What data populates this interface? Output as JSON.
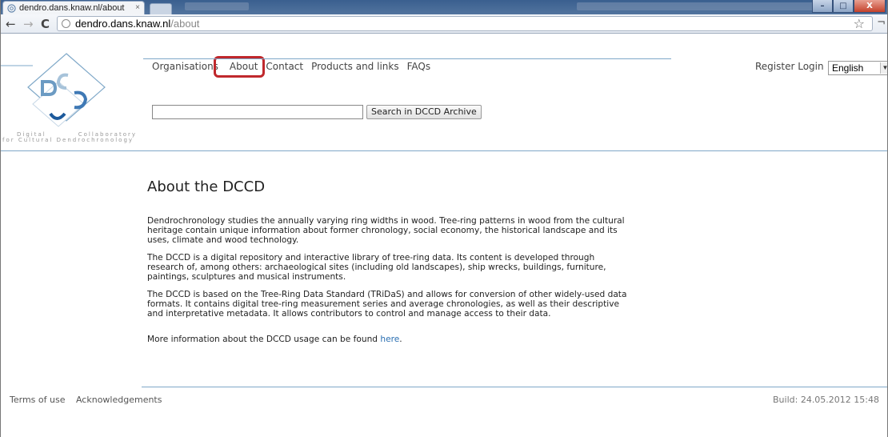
{
  "browser": {
    "tab_title": "dendro.dans.knaw.nl/about",
    "url_host": "dendro.dans.knaw.nl",
    "url_path": "/about"
  },
  "logo": {
    "text_line1_left": "Digital",
    "text_line1_right": "Collaboratory",
    "text_line2": "for Cultural Dendrochronology"
  },
  "nav": {
    "items": [
      "Organisations",
      "About",
      "Contact",
      "Products and links",
      "FAQs"
    ],
    "highlighted": "About"
  },
  "user": {
    "register": "Register",
    "login": "Login",
    "language": "English"
  },
  "search": {
    "value": "",
    "button_label": "Search in DCCD Archive"
  },
  "content": {
    "title": "About the DCCD",
    "paragraphs": [
      "Dendrochronology studies the annually varying ring widths in wood. Tree-ring patterns in wood from the cultural heritage contain unique information about former chronology, social economy, the historical landscape and its uses, climate and wood technology.",
      "The DCCD is a digital repository and interactive library of tree-ring data. Its content is developed through research of, among others: archaeological sites (including old landscapes), ship wrecks, buildings, furniture, paintings, sculptures and musical instruments.",
      "The DCCD is based on the Tree-Ring Data Standard (TRiDaS) and allows for conversion of other widely-used data formats. It contains digital tree-ring measurement series and average chronologies, as well as their descriptive and interpretative metadata. It allows contributors to control and manage access to their data."
    ],
    "more_text": "More information about the DCCD usage can be found",
    "more_link": "here",
    "more_end": "."
  },
  "footer": {
    "terms": "Terms of use",
    "acknowledgements": "Acknowledgements",
    "build": "Build: 24.05.2012 15:48"
  },
  "colors": {
    "accent_line": "#7fa8c8",
    "highlight_border": "#c0282c",
    "link": "#2a6fb2"
  }
}
